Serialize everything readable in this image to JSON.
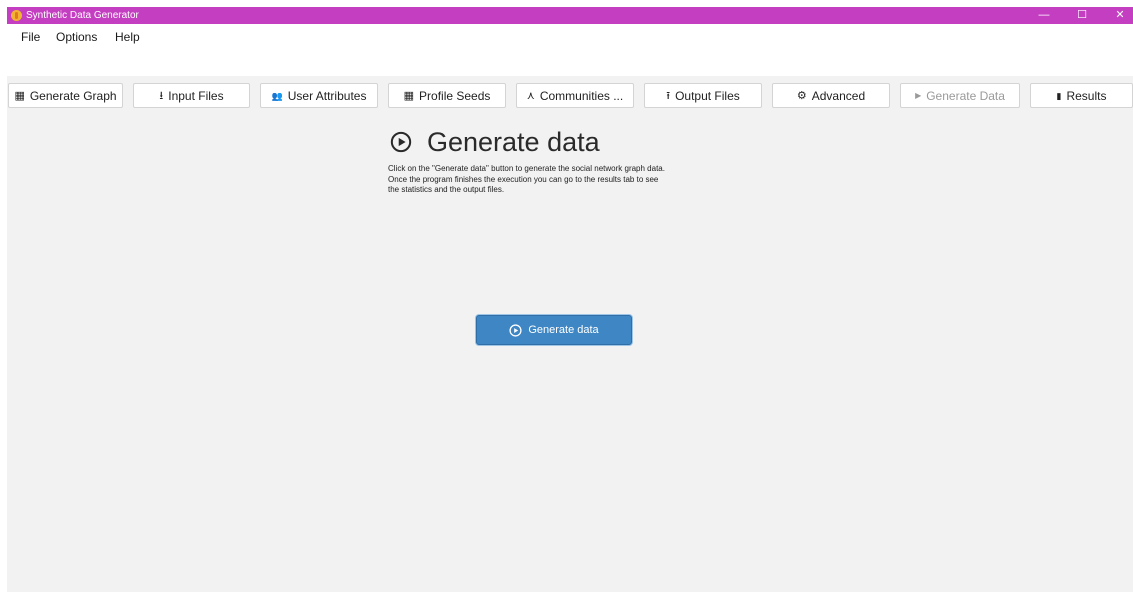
{
  "window": {
    "title": "Synthetic Data Generator",
    "controls": {
      "minimize": "—",
      "maximize": "☐",
      "close": "✕"
    }
  },
  "menu": {
    "items": [
      {
        "label": "File"
      },
      {
        "label": "Options"
      },
      {
        "label": "Help"
      }
    ]
  },
  "tabs": [
    {
      "label": "Generate Graph",
      "icon": "grid-icon",
      "glyph": "▦",
      "enabled": true
    },
    {
      "label": "Input Files",
      "icon": "download-icon",
      "glyph": "⭳",
      "enabled": true
    },
    {
      "label": "User Attributes",
      "icon": "users-icon",
      "glyph": "👥",
      "enabled": true
    },
    {
      "label": "Profile Seeds",
      "icon": "grid-icon",
      "glyph": "▦",
      "enabled": true
    },
    {
      "label": "Communities ...",
      "icon": "network-icon",
      "glyph": "⋏",
      "enabled": true
    },
    {
      "label": "Output Files",
      "icon": "upload-icon",
      "glyph": "⭱",
      "enabled": true
    },
    {
      "label": "Advanced",
      "icon": "gear-icon",
      "glyph": "⚙",
      "enabled": true
    },
    {
      "label": "Generate Data",
      "icon": "play-icon",
      "glyph": "▶",
      "enabled": false
    },
    {
      "label": "Results",
      "icon": "bar-chart-icon",
      "glyph": "▮",
      "enabled": true
    }
  ],
  "main": {
    "title": "Generate data",
    "description": [
      "Click on the \"Generate data\" button to generate the social network graph data.",
      "Once the program finishes the execution you can go to the results tab to see",
      "the statistics and the output files."
    ],
    "button_label": "Generate data"
  },
  "colors": {
    "titlebar": "#c43ec1",
    "background": "#f2f2f2",
    "primary_button": "#3e86c4"
  }
}
